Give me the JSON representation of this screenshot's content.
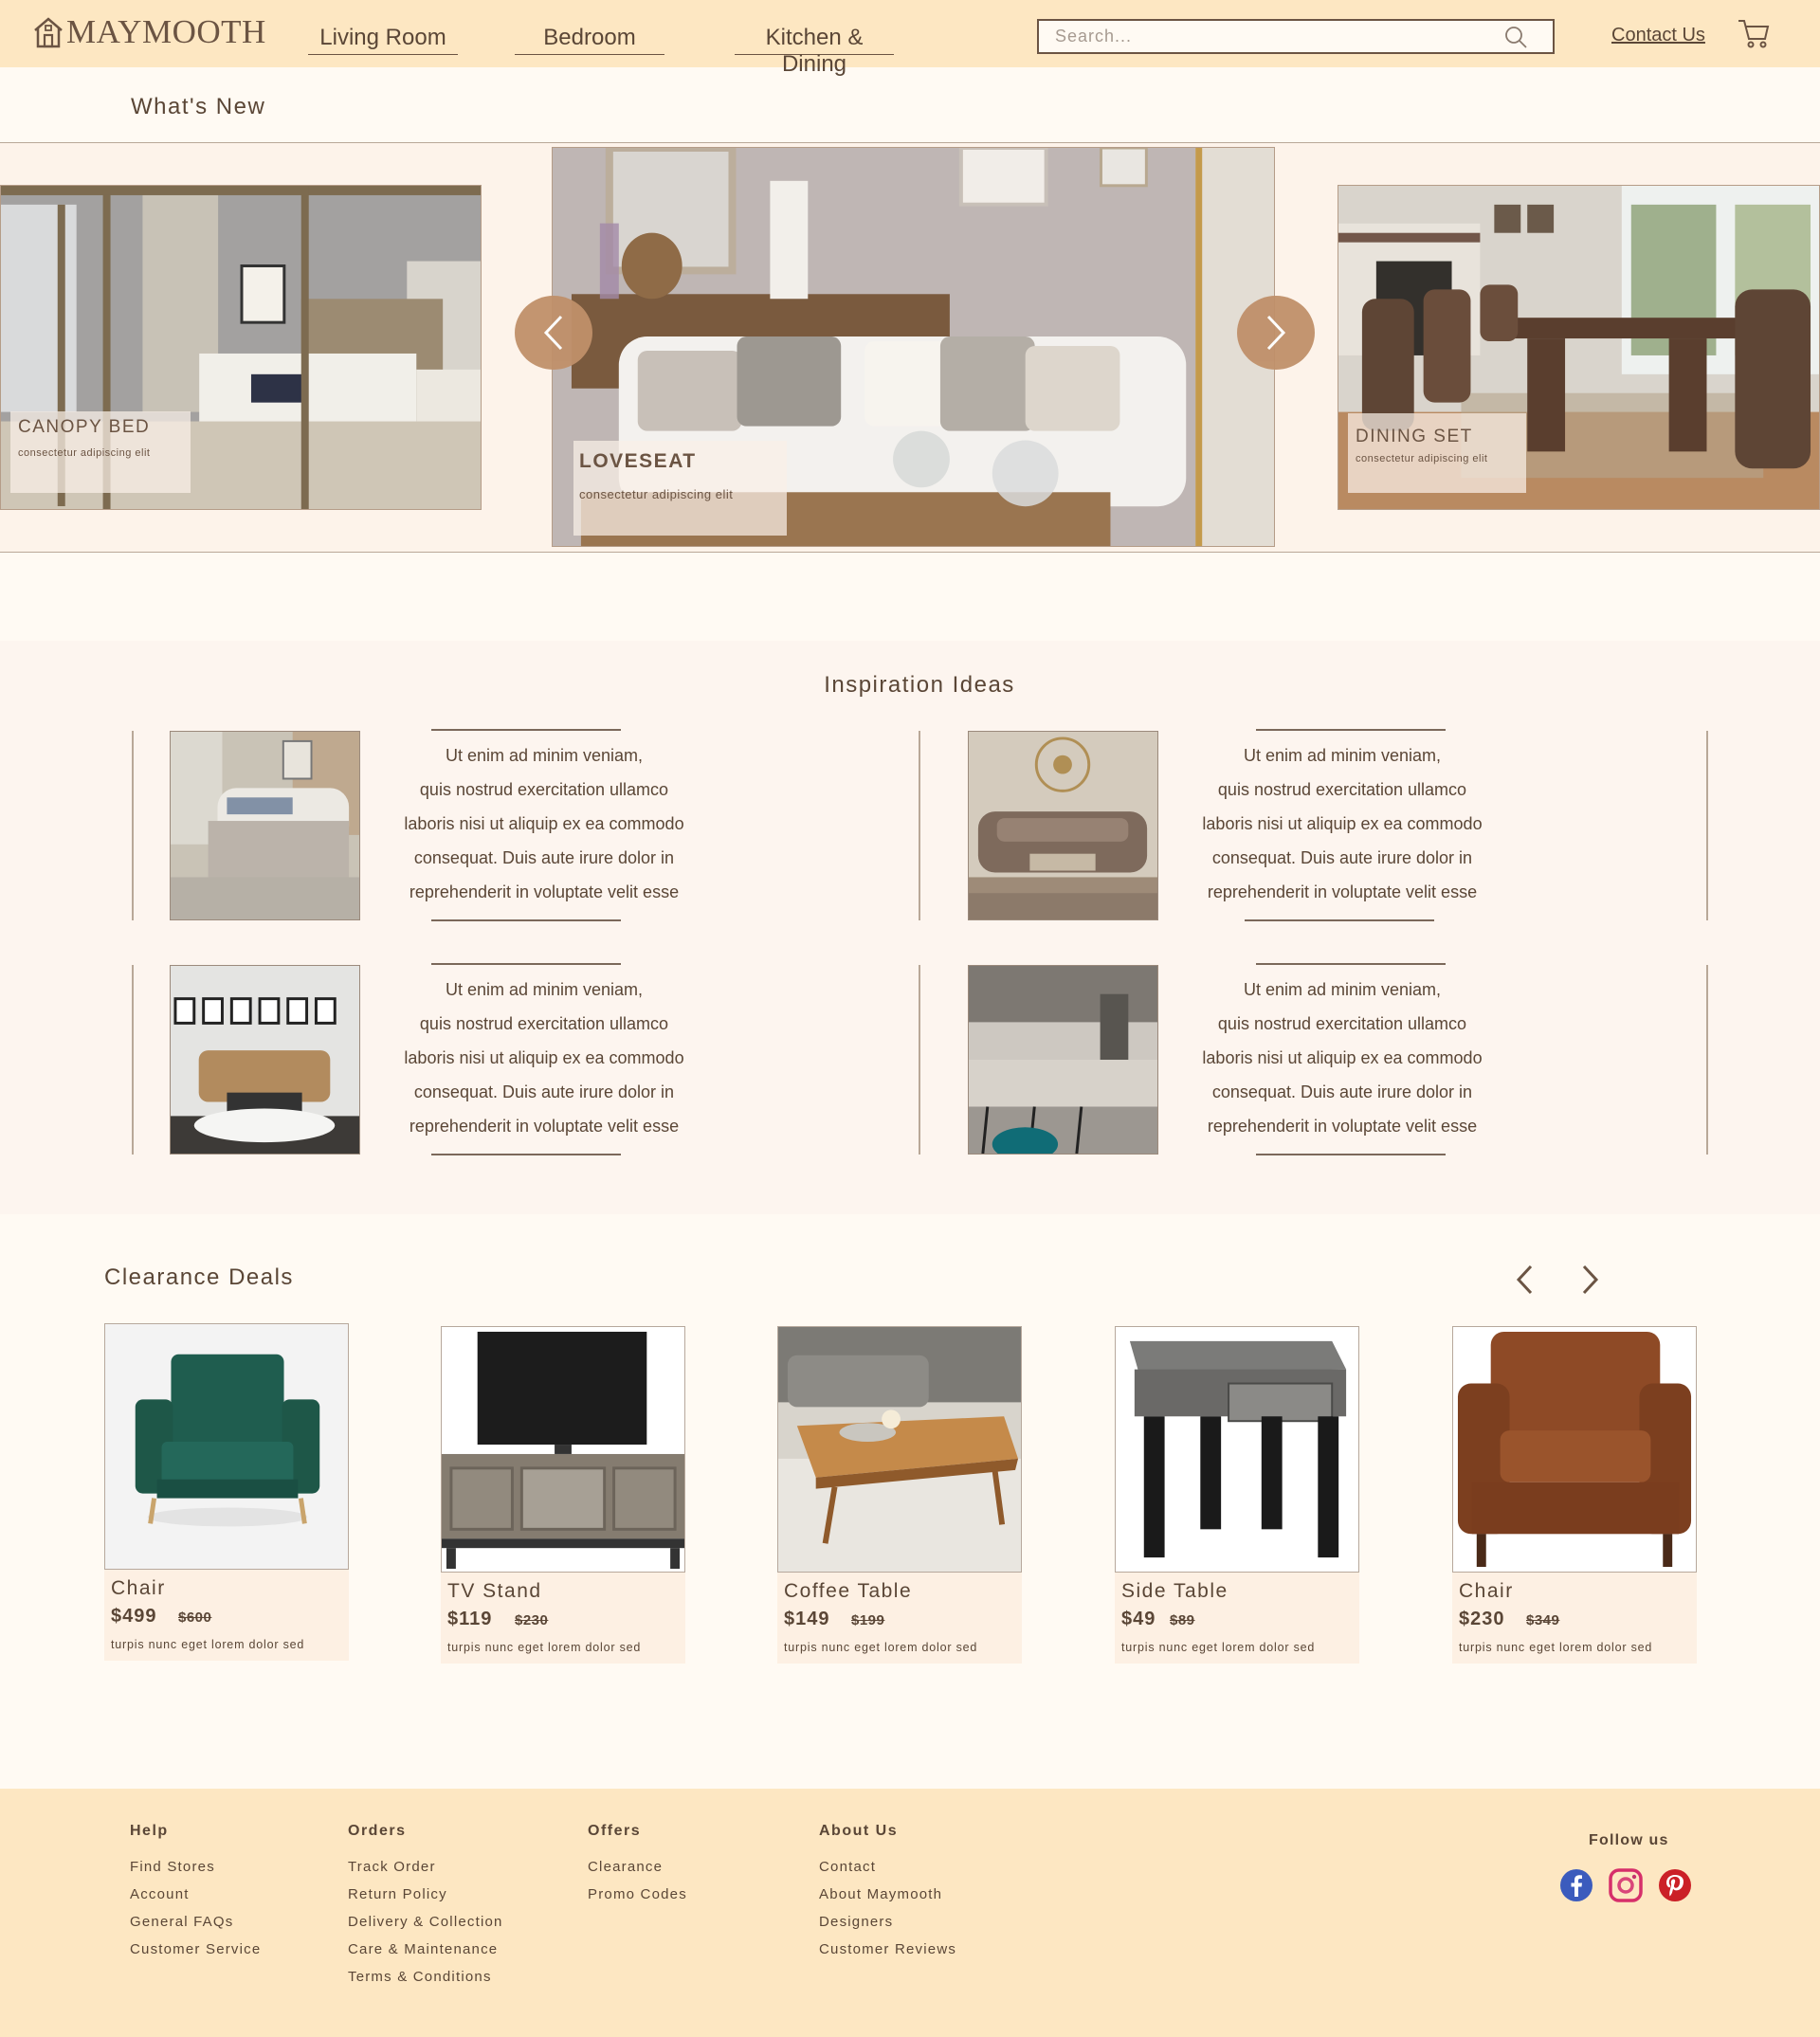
{
  "brand": {
    "name": "MAYMOOTH"
  },
  "nav": {
    "items": [
      {
        "label": "Living Room"
      },
      {
        "label": "Bedroom"
      },
      {
        "label": "Kitchen & Dining"
      }
    ]
  },
  "search": {
    "placeholder": "Search...",
    "value": ""
  },
  "header": {
    "contact_label": "Contact Us"
  },
  "whats_new": {
    "title": "What's New",
    "slides": [
      {
        "title": "CANOPY BED",
        "subtitle": "consectetur adipiscing elit"
      },
      {
        "title": "LOVESEAT",
        "subtitle": "consectetur adipiscing elit"
      },
      {
        "title": "DINING SET",
        "subtitle": "consectetur adipiscing elit"
      }
    ]
  },
  "inspiration": {
    "title": "Inspiration Ideas",
    "cards": [
      {
        "lines": [
          "Ut enim ad minim veniam,",
          "quis nostrud exercitation ullamco",
          "laboris nisi ut aliquip ex ea commodo",
          "consequat. Duis aute irure dolor in",
          "reprehenderit in voluptate velit esse"
        ]
      },
      {
        "lines": [
          "Ut enim ad minim veniam,",
          "quis nostrud exercitation ullamco",
          "laboris nisi ut aliquip ex ea commodo",
          "consequat. Duis aute irure dolor in",
          "reprehenderit in voluptate velit esse"
        ]
      },
      {
        "lines": [
          "Ut enim ad minim veniam,",
          "quis nostrud exercitation ullamco",
          "laboris nisi ut aliquip ex ea commodo",
          "consequat. Duis aute irure dolor in",
          "reprehenderit in voluptate velit esse"
        ]
      },
      {
        "lines": [
          "Ut enim ad minim veniam,",
          "quis nostrud exercitation ullamco",
          "laboris nisi ut aliquip ex ea commodo",
          "consequat. Duis aute irure dolor in",
          "reprehenderit in voluptate velit esse"
        ]
      }
    ]
  },
  "clearance": {
    "title": "Clearance Deals",
    "products": [
      {
        "name": "Chair",
        "price": "$499",
        "old_price": "$600",
        "desc": "turpis nunc eget lorem dolor sed"
      },
      {
        "name": "TV Stand",
        "price": "$119",
        "old_price": "$230",
        "desc": "turpis nunc eget lorem dolor sed"
      },
      {
        "name": "Coffee Table",
        "price": "$149",
        "old_price": "$199",
        "desc": "turpis nunc eget lorem dolor sed"
      },
      {
        "name": "Side Table",
        "price": "$49",
        "old_price": "$89",
        "desc": "turpis nunc eget lorem dolor sed"
      },
      {
        "name": "Chair",
        "price": "$230",
        "old_price": "$349",
        "desc": "turpis nunc eget lorem dolor sed"
      }
    ]
  },
  "footer": {
    "columns": [
      {
        "heading": "Help",
        "links": [
          "Find Stores",
          "Account",
          "General FAQs",
          "Customer Service"
        ]
      },
      {
        "heading": "Orders",
        "links": [
          "Track Order",
          "Return Policy",
          "Delivery & Collection",
          "Care & Maintenance",
          "Terms & Conditions"
        ]
      },
      {
        "heading": "Offers",
        "links": [
          "Clearance",
          "Promo Codes"
        ]
      },
      {
        "heading": "About Us",
        "links": [
          "Contact",
          "About Maymooth",
          "Designers",
          "Customer Reviews"
        ]
      }
    ],
    "follow_label": "Follow us",
    "social": [
      "facebook-icon",
      "instagram-icon",
      "pinterest-icon"
    ]
  },
  "colors": {
    "header_bg": "#fde7c2",
    "page_bg": "#fffaf3",
    "accent": "#c0906a",
    "text": "#5a4636"
  }
}
